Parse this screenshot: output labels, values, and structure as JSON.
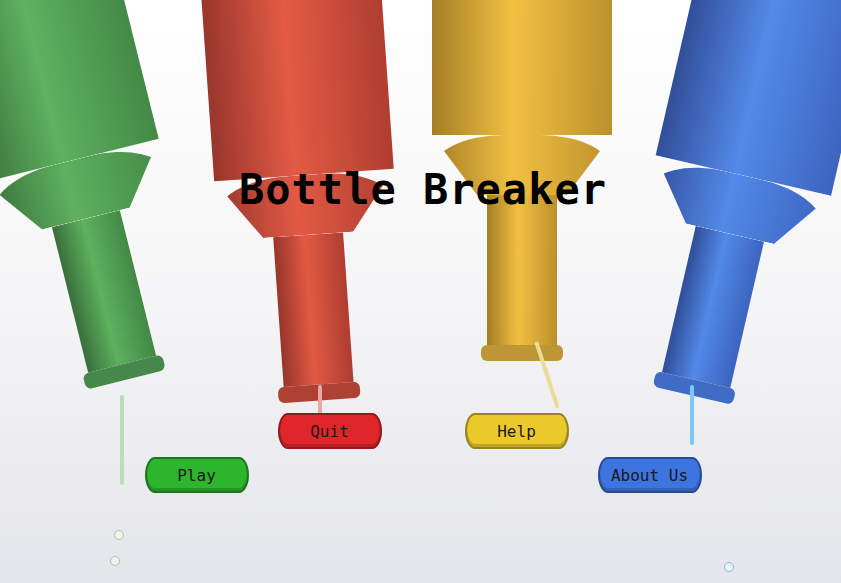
{
  "title": "Bottle Breaker",
  "buttons": [
    {
      "label": "Play",
      "color": "#2db52d"
    },
    {
      "label": "Quit",
      "color": "#e0262a"
    },
    {
      "label": "Help",
      "color": "#ecc92a"
    },
    {
      "label": "About Us",
      "color": "#3e74e0"
    }
  ]
}
